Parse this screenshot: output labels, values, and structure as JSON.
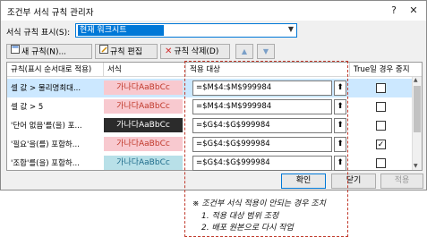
{
  "window": {
    "title": "조건부 서식 규칙 관리자",
    "help": "?",
    "close": "✕"
  },
  "show_rules": {
    "label": "서식 규칙 표시(S):",
    "value": "현재 워크시트"
  },
  "toolbar": {
    "new_rule": "새 규칙(N)...",
    "edit_rule": "규칙 편집(E)...",
    "delete_rule": "규칙 삭제(D)"
  },
  "columns": {
    "rule": "규칙(표시 순서대로 적용)",
    "format": "서식",
    "applies_to": "적용 대상",
    "stop_if_true": "True일 경우 중지"
  },
  "rows": [
    {
      "rule": "셀 값 > 물리명최대...",
      "preview": "가나다AaBbCc",
      "range": "=$M$4:$M$999984",
      "stop": ""
    },
    {
      "rule": "셀 값 > 5",
      "preview": "가나다AaBbCc",
      "range": "=$M$4:$M$999984",
      "stop": ""
    },
    {
      "rule": "'단어 없음'를(을) 포...",
      "preview": "가나다AaBbCc",
      "range": "=$G$4:$G$999984",
      "stop": ""
    },
    {
      "rule": "'필요'을(를) 포함하...",
      "preview": "가나다AaBbCc",
      "range": "=$G$4:$G$999984",
      "stop": "✓"
    },
    {
      "rule": "'조합'를(을) 포함하...",
      "preview": "가나다AaBbCc",
      "range": "=$G$4:$G$999984",
      "stop": ""
    }
  ],
  "row_styles": [
    {
      "bg": "#f8c9cf",
      "fg": "#c0392b"
    },
    {
      "bg": "#f8c9cf",
      "fg": "#c0392b"
    },
    {
      "bg": "#2b2b2b",
      "fg": "#ffffff"
    },
    {
      "bg": "#f8c9cf",
      "fg": "#c0392b"
    },
    {
      "bg": "#b8e0e8",
      "fg": "#1e6b8a"
    }
  ],
  "buttons": {
    "ok": "확인",
    "close": "닫기",
    "apply": "적용"
  },
  "note": {
    "heading": "※ 조건부 서식 적용이 안되는 경우 조치",
    "step1": "1.  적용 대상 범위 조정",
    "step2": "2.  배포 원본으로 다시 작업"
  }
}
